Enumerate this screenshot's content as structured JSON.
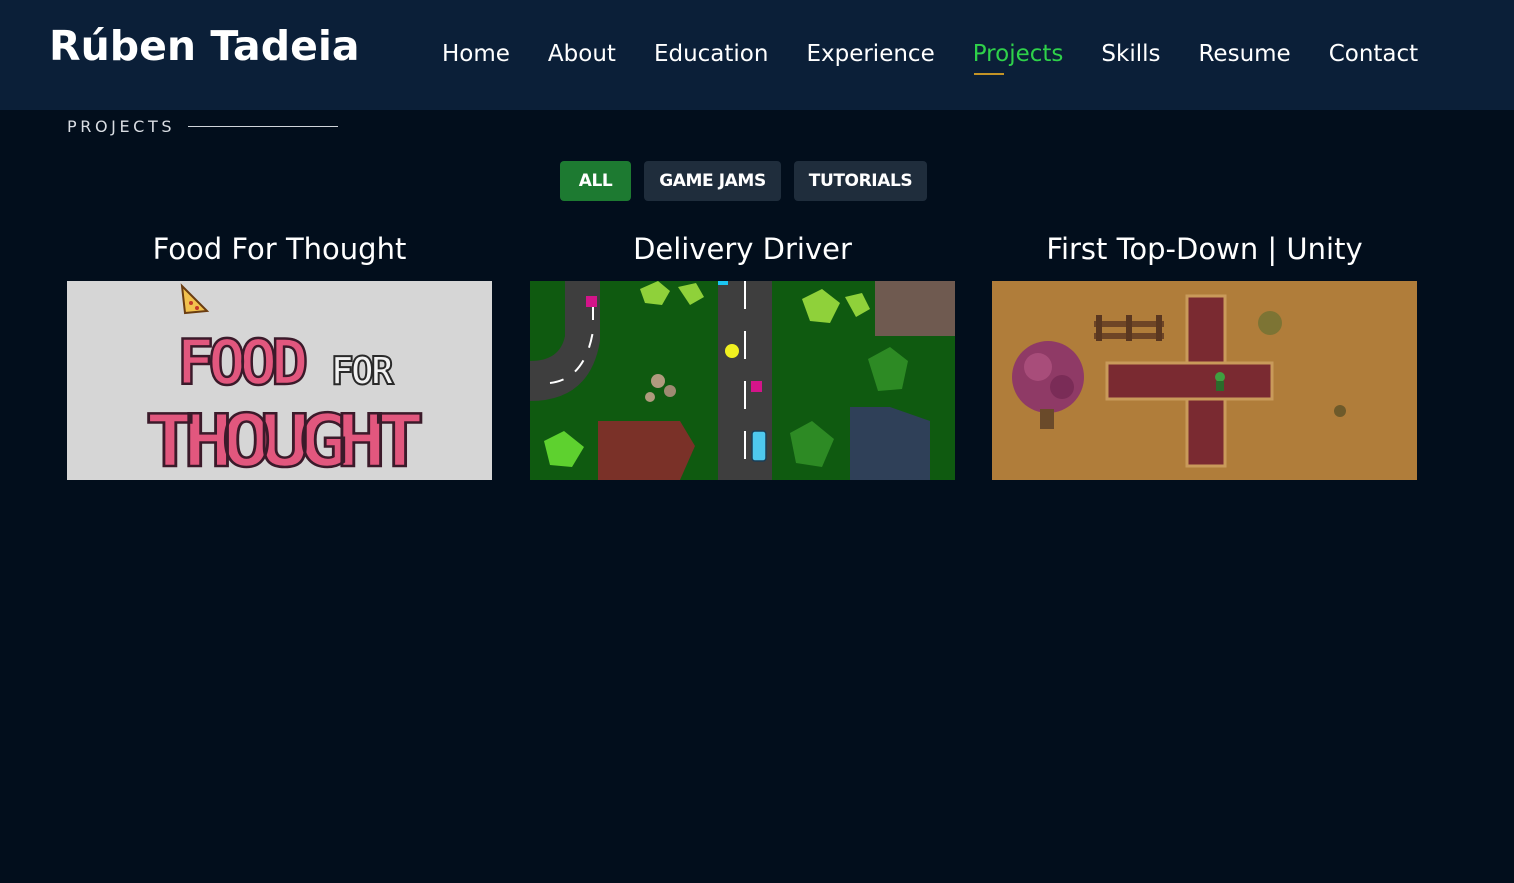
{
  "header": {
    "brand": "Rúben Tadeia",
    "nav": [
      {
        "label": "Home",
        "active": false
      },
      {
        "label": "About",
        "active": false
      },
      {
        "label": "Education",
        "active": false
      },
      {
        "label": "Experience",
        "active": false
      },
      {
        "label": "Projects",
        "active": true
      },
      {
        "label": "Skills",
        "active": false
      },
      {
        "label": "Resume",
        "active": false
      },
      {
        "label": "Contact",
        "active": false
      }
    ]
  },
  "section": {
    "title": "PROJECTS"
  },
  "filters": [
    {
      "label": "ALL",
      "active": true
    },
    {
      "label": "GAME JAMS",
      "active": false
    },
    {
      "label": "TUTORIALS",
      "active": false
    }
  ],
  "projects": [
    {
      "title": "Food For Thought",
      "thumb_text_1": "FOOD",
      "thumb_text_2": "FOR",
      "thumb_text_3": "THOUGHT"
    },
    {
      "title": "Delivery Driver"
    },
    {
      "title": "First Top-Down | Unity"
    }
  ],
  "colors": {
    "background": "#020e1c",
    "header": "#0b1f38",
    "active_nav": "#2fd14a",
    "nav_underline": "#c39326",
    "filter_active": "#1d7a31",
    "filter_inactive": "#1f2d3c"
  }
}
